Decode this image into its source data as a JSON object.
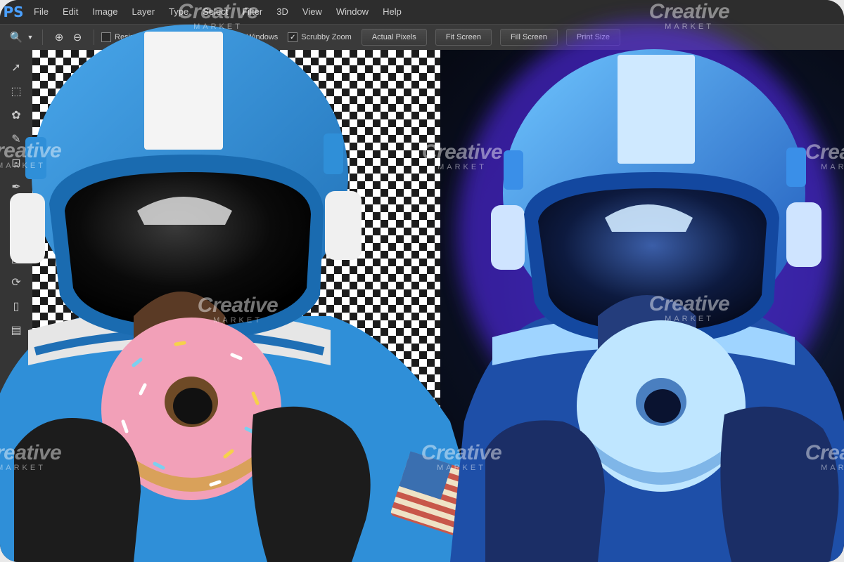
{
  "app": {
    "logo": "PS"
  },
  "menu": [
    "File",
    "Edit",
    "Image",
    "Layer",
    "Type",
    "Select",
    "Filter",
    "3D",
    "View",
    "Window",
    "Help"
  ],
  "options_bar": {
    "resize_windows_label": "Resize Windows to Fit",
    "zoom_all_windows_label": "Zoom All Windows",
    "scrubby_zoom_label": "Scrubby Zoom",
    "scrubby_zoom_checked": true,
    "buttons": [
      "Actual Pixels",
      "Fit Screen",
      "Fill Screen",
      "Print Size"
    ]
  },
  "tools": [
    "move-tool",
    "marquee-tool",
    "lasso-tool",
    "quick-select-tool",
    "crop-tool",
    "eyedropper-tool",
    "healing-tool",
    "brush-tool",
    "stamp-tool",
    "history-brush-tool",
    "eraser-tool",
    "gradient-tool"
  ],
  "watermark": {
    "brand": "Creative",
    "sub": "MARKET"
  },
  "colors": {
    "suit_blue": "#2f8fd8",
    "glow": "#6a3cff",
    "donut_pink": "#f2a0b8",
    "checker_dark": "#1d1d1d"
  }
}
